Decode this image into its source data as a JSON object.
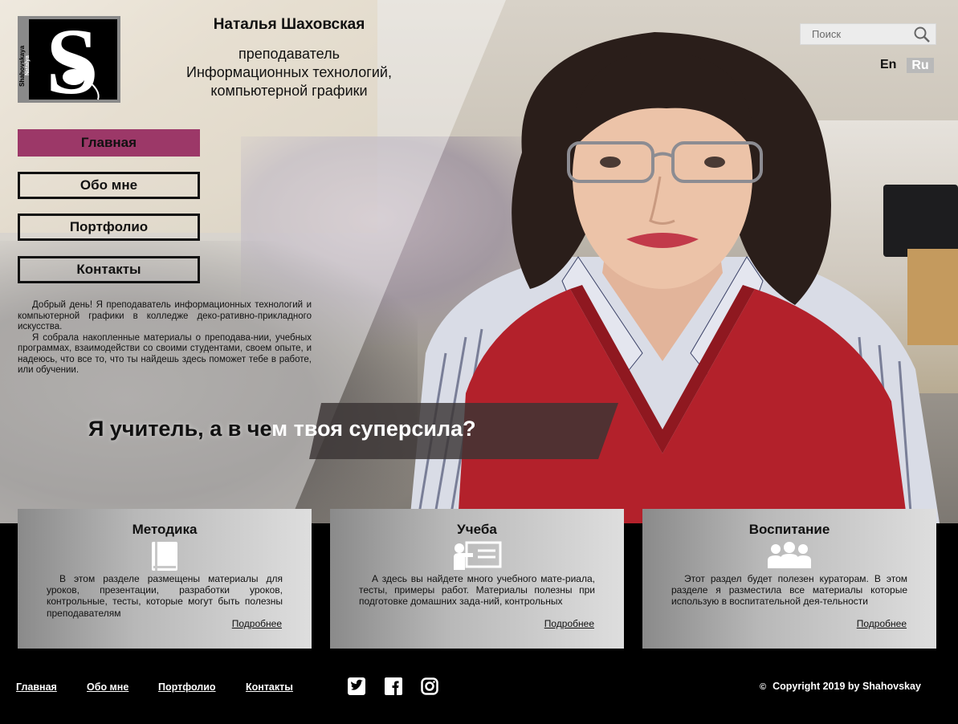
{
  "logo": {
    "letter": "S",
    "vertical_text_1": "Shahovskaya",
    "vertical_text_2": "Natalya"
  },
  "header": {
    "name": "Наталья Шаховская",
    "role_line1": "преподаватель",
    "role_line2": "Информационных технологий,",
    "role_line3": "компьютерной графики"
  },
  "search": {
    "placeholder": "Поиск",
    "icon": "search-icon"
  },
  "lang": {
    "en": "En",
    "ru": "Ru",
    "active": "Ru"
  },
  "nav": [
    {
      "label": "Главная",
      "active": true
    },
    {
      "label": "Обо мне",
      "active": false
    },
    {
      "label": "Портфолио",
      "active": false
    },
    {
      "label": "Контакты",
      "active": false
    }
  ],
  "intro": {
    "p1": "Добрый день! Я преподаватель информационных технологий и компьютерной графики в колледже деко-ративно-прикладного искусства.",
    "p2": "Я собрала накопленные материалы о преподава-нии, учебных программах, взаимодействи со своими студентами, своем опыте, и надеюсь, что все то, что ты найдешь здесь поможет тебе в работе, или обучении."
  },
  "slogan": {
    "dark": "Я учитель, а в че",
    "light": "м твоя суперсила?"
  },
  "cards": [
    {
      "title": "Методика",
      "icon": "book-icon",
      "text": "В этом разделе размещены материалы для уроков, презентации, разработки уроков, контрольные, тесты, которые могут быть полезны преподавателям",
      "more": "Подробнее"
    },
    {
      "title": "Учеба",
      "icon": "teacher-board-icon",
      "text": "А здесь вы найдете много учебного мате-риала, тесты, примеры работ. Материалы полезны при подготовке домашних зада-ний, контрольных",
      "more": "Подробнее"
    },
    {
      "title": "Воспитание",
      "icon": "group-icon",
      "text": "Этот раздел будет полезен кураторам. В этом разделе я разместила все материалы которые использую в воспитательной дея-тельности",
      "more": "Подробнее"
    }
  ],
  "footer": {
    "links": [
      "Главная",
      "Обо мне",
      "Портфолио",
      "Контакты"
    ],
    "social": [
      "twitter-icon",
      "facebook-icon",
      "instagram-icon"
    ],
    "copyright_symbol": "©",
    "copyright": "Copyright 2019 by Shahovskay"
  },
  "colors": {
    "accent": "#9c3868",
    "footer_bg": "#000000",
    "sweater_red": "#b8202a"
  }
}
